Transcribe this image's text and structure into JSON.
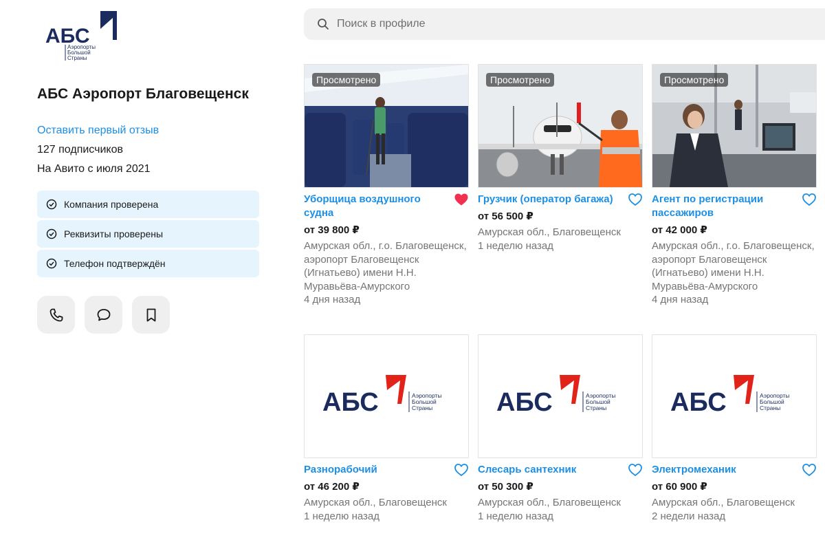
{
  "profile": {
    "logo_main": "АБС",
    "logo_sub1": "Аэропорты",
    "logo_sub2": "Большой",
    "logo_sub3": "Страны",
    "name": "АБС Аэропорт Благовещенск",
    "review_link": "Оставить первый отзыв",
    "subscribers": "127 подписчиков",
    "since": "На Авито с июля 2021",
    "badges": [
      {
        "label": "Компания проверена",
        "icon": "check-circle-icon"
      },
      {
        "label": "Реквизиты проверены",
        "icon": "check-circle-icon"
      },
      {
        "label": "Телефон подтверждён",
        "icon": "check-circle-icon"
      }
    ],
    "actions": [
      "phone-icon",
      "chat-icon",
      "bookmark-icon"
    ]
  },
  "search": {
    "placeholder": "Поиск в профиле",
    "icon": "search-icon"
  },
  "viewed_label": "Просмотрено",
  "listings": [
    {
      "title": "Уборщица воздушного судна",
      "price": "от 39 800 ₽",
      "location": "Амурская обл., г.о. Благовещенск, аэропорт Благовещенск (Игнатьево) имени Н.Н. Муравьёва-Амурского",
      "date": "4 дня назад",
      "viewed": true,
      "favorite": true,
      "image": "cabin-cleaning-photo"
    },
    {
      "title": "Грузчик (оператор багажа)",
      "price": "от 56 500 ₽",
      "location": "Амурская обл., Благовещенск",
      "date": "1 неделю назад",
      "viewed": true,
      "favorite": false,
      "image": "airplane-marshaller-photo"
    },
    {
      "title": "Агент по регистрации пассажиров",
      "price": "от 42 000 ₽",
      "location": "Амурская обл., г.о. Благовещенск, аэропорт Благовещенск (Игнатьево) имени Н.Н. Муравьёва-Амурского",
      "date": "4 дня назад",
      "viewed": true,
      "favorite": false,
      "image": "checkin-desk-photo"
    },
    {
      "title": "Разнорабочий",
      "price": "от 46 200 ₽",
      "location": "Амурская обл., Благовещенск",
      "date": "1 неделю назад",
      "viewed": false,
      "favorite": false,
      "image": "abs-logo"
    },
    {
      "title": "Слесарь сантехник",
      "price": "от 50 300 ₽",
      "location": "Амурская обл., Благовещенск",
      "date": "1 неделю назад",
      "viewed": false,
      "favorite": false,
      "image": "abs-logo"
    },
    {
      "title": "Электромеханик",
      "price": "от 60 900 ₽",
      "location": "Амурская обл., Благовещенск",
      "date": "2 недели назад",
      "viewed": false,
      "favorite": false,
      "image": "abs-logo"
    }
  ],
  "colors": {
    "link": "#1c8fe5",
    "favorite": "#f0314f",
    "badge_bg": "#e6f4fd",
    "brand_navy": "#1b2b5e",
    "brand_red": "#e2231a"
  }
}
